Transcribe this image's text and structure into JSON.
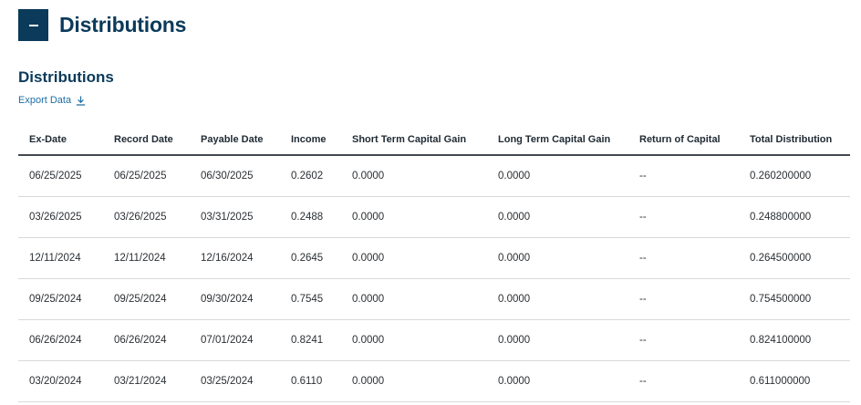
{
  "section": {
    "toggle_symbol": "−",
    "title": "Distributions"
  },
  "subtitle": "Distributions",
  "export": {
    "label": "Export Data",
    "icon": "download-icon"
  },
  "table": {
    "columns": [
      "Ex-Date",
      "Record Date",
      "Payable Date",
      "Income",
      "Short Term Capital Gain",
      "Long Term Capital Gain",
      "Return of Capital",
      "Total Distribution"
    ],
    "rows": [
      [
        "06/25/2025",
        "06/25/2025",
        "06/30/2025",
        "0.2602",
        "0.0000",
        "0.0000",
        "--",
        "0.260200000"
      ],
      [
        "03/26/2025",
        "03/26/2025",
        "03/31/2025",
        "0.2488",
        "0.0000",
        "0.0000",
        "--",
        "0.248800000"
      ],
      [
        "12/11/2024",
        "12/11/2024",
        "12/16/2024",
        "0.2645",
        "0.0000",
        "0.0000",
        "--",
        "0.264500000"
      ],
      [
        "09/25/2024",
        "09/25/2024",
        "09/30/2024",
        "0.7545",
        "0.0000",
        "0.0000",
        "--",
        "0.754500000"
      ],
      [
        "06/26/2024",
        "06/26/2024",
        "07/01/2024",
        "0.8241",
        "0.0000",
        "0.0000",
        "--",
        "0.824100000"
      ],
      [
        "03/20/2024",
        "03/21/2024",
        "03/25/2024",
        "0.6110",
        "0.0000",
        "0.0000",
        "--",
        "0.611000000"
      ]
    ]
  },
  "colors": {
    "brand": "#0b3a5a",
    "link": "#1d6fa5"
  }
}
